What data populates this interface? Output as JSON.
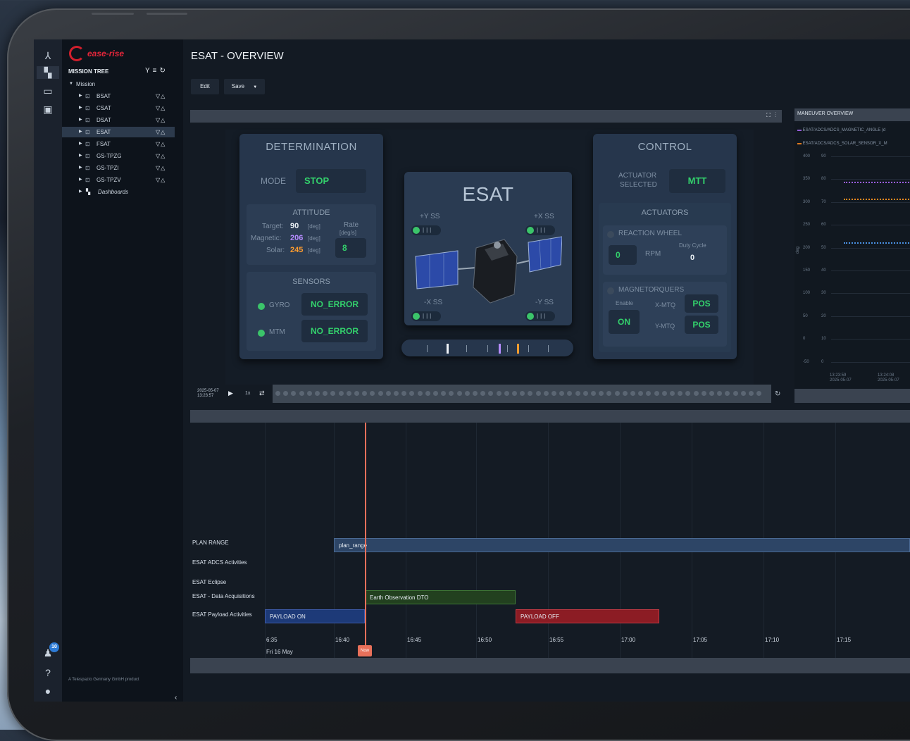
{
  "brand": {
    "name": "ease-rise",
    "footer": "A Telespazio Germany GmbH product"
  },
  "notifications": {
    "count": "10"
  },
  "sidebar": {
    "title": "MISSION TREE",
    "root": "Mission",
    "items": [
      {
        "label": "BSAT",
        "flags": "▽△"
      },
      {
        "label": "CSAT",
        "flags": "▽△"
      },
      {
        "label": "DSAT",
        "flags": "▽△"
      },
      {
        "label": "ESAT",
        "flags": "▽△"
      },
      {
        "label": "FSAT",
        "flags": "▽△"
      },
      {
        "label": "GS-TPZG",
        "flags": "▽△"
      },
      {
        "label": "GS-TPZI",
        "flags": "▽△"
      },
      {
        "label": "GS-TPZV",
        "flags": "▽△"
      }
    ],
    "dashboards": "Dashboards"
  },
  "page": {
    "title": "ESAT - OVERVIEW"
  },
  "toolbar": {
    "edit": "Edit",
    "save": "Save"
  },
  "determination": {
    "title": "DETERMINATION",
    "mode_label": "MODE",
    "mode_value": "STOP",
    "attitude_title": "ATTITUDE",
    "target_label": "Target:",
    "target_value": "90",
    "magnetic_label": "Magnetic:",
    "magnetic_value": "206",
    "solar_label": "Solar:",
    "solar_value": "245",
    "unit": "[deg]",
    "rate_label": "Rate",
    "rate_unit": "[deg/s]",
    "rate_value": "8",
    "sensors_title": "SENSORS",
    "gyro_label": "GYRO",
    "gyro_value": "NO_ERROR",
    "mtm_label": "MTM",
    "mtm_value": "NO_ERROR"
  },
  "satellite": {
    "name": "ESAT",
    "pos_y": "+Y SS",
    "pos_x": "+X SS",
    "neg_x": "-X SS",
    "neg_y": "-Y SS"
  },
  "control": {
    "title": "CONTROL",
    "actuator_label_1": "ACTUATOR",
    "actuator_label_2": "SELECTED",
    "actuator_value": "MTT",
    "actuators_title": "ACTUATORS",
    "rw_title": "REACTION WHEEL",
    "rpm_value": "0",
    "rpm_label": "RPM",
    "duty_label": "Duty Cycle",
    "duty_value": "0",
    "mtq_title": "MAGNETORQUERS",
    "enable_label": "Enable",
    "enable_value": "ON",
    "xmtq_label": "X-MTQ",
    "xmtq_value": "POS",
    "ymtq_label": "Y-MTQ",
    "ymtq_value": "POS"
  },
  "playback": {
    "date": "2025-05-07",
    "time": "13:23:57",
    "speed": "1x"
  },
  "maneuver": {
    "title": "MANEUVER OVERVIEW",
    "legend_1": "ESAT/ADCS/ADCS_MAGNETIC_ANGLE (d",
    "legend_2": "ESAT/ADCS/ADCS_SOLAR_SENSOR_X_M",
    "y_left": [
      "400",
      "350",
      "300",
      "250",
      "200",
      "150",
      "100",
      "50",
      "0",
      "-50"
    ],
    "y_right": [
      "90",
      "80",
      "70",
      "60",
      "50",
      "40",
      "30",
      "20",
      "10",
      "0"
    ],
    "axis_label": "deg",
    "x1_time": "13:23:59",
    "x1_date": "2025-05-07",
    "x2_time": "13:24:08",
    "x2_date": "2025-05-07"
  },
  "gantt": {
    "rows": [
      "PLAN RANGE",
      "ESAT ADCS Activities",
      "ESAT Eclipse",
      "ESAT - Data Acquisitions",
      "ESAT Payload Activities"
    ],
    "bars": {
      "plan_range": "plan_range",
      "earth_obs": "Earth Observation DTO",
      "payload_on": "PAYLOAD ON",
      "payload_off": "PAYLOAD OFF"
    },
    "ticks": [
      "6:35",
      "16:40",
      "16:45",
      "16:50",
      "16:55",
      "17:00",
      "17:05",
      "17:10",
      "17:15"
    ],
    "date": "Fri 16 May",
    "now": "Now"
  },
  "colors": {
    "accent_green": "#33d16c",
    "brand_red": "#e3263a",
    "now_line": "#e8705a"
  }
}
